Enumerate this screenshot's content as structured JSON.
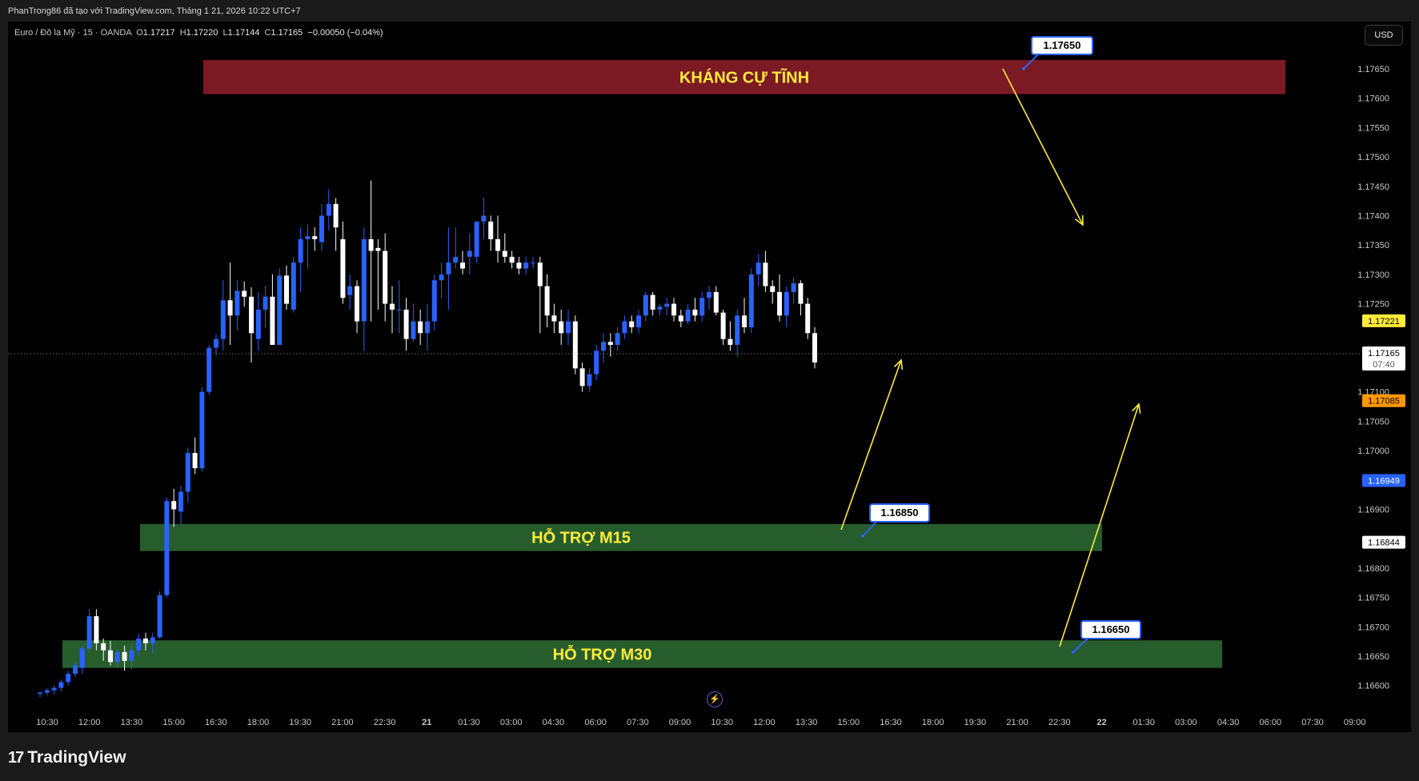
{
  "attribution": "PhanTrong86 đã tạo với TradingView.com, Tháng 1 21, 2026 10:22 UTC+7",
  "legend": {
    "symbol": "Euro / Đô la Mỹ · 15 · OANDA",
    "open_label": "O",
    "open": "1.17217",
    "high_label": "H",
    "high": "1.17220",
    "low_label": "L",
    "low": "1.17144",
    "close_label": "C",
    "close": "1.17165",
    "change": "−0.00050 (−0.04%)"
  },
  "currency_button": "USD",
  "branding": {
    "logo_mark": "17",
    "name": "TradingView"
  },
  "icons": {
    "logo": "tradingview-logo-icon",
    "lightning": "lightning-icon"
  },
  "colors": {
    "bullish": "#2962ff",
    "bearish": "#ffffff",
    "resistance_zone": "#7c1a23",
    "support_zone": "#275d2c",
    "zone_text": "#ffeb3b",
    "arrows": "#ffeb3b",
    "background": "#000000"
  },
  "chart_data": {
    "type": "candlestick",
    "symbol": "EURUSD",
    "timeframe": "15",
    "ylim": [
      1.1656,
      1.1774
    ],
    "x_tick_labels": [
      "10:30",
      "12:00",
      "13:30",
      "15:00",
      "16:30",
      "18:00",
      "19:30",
      "21:00",
      "22:30",
      "21",
      "01:30",
      "03:00",
      "04:30",
      "06:00",
      "07:30",
      "09:00",
      "10:30",
      "12:00",
      "13:30",
      "15:00",
      "16:30",
      "18:00",
      "19:30",
      "21:00",
      "22:30",
      "22",
      "01:30",
      "03:00",
      "04:30",
      "06:00",
      "07:30",
      "09:00"
    ],
    "y_tick_labels": [
      "1.17650",
      "1.17600",
      "1.17550",
      "1.17500",
      "1.17450",
      "1.17400",
      "1.17350",
      "1.17300",
      "1.17250",
      "1.17100",
      "1.17050",
      "1.17000",
      "1.16900",
      "1.16800",
      "1.16750",
      "1.16700",
      "1.16650",
      "1.16600"
    ],
    "price_labels": [
      {
        "value": "1.17221",
        "color": "#ffeb3b",
        "text_color": "#000000"
      },
      {
        "value": "1.17165",
        "color": "#26a69a",
        "text_color": "#ffffff"
      },
      {
        "value": "1.17165",
        "color": "#ffffff",
        "text_color": "#000000",
        "sub": "07:40"
      },
      {
        "value": "1.17085",
        "color": "#ff9800",
        "text_color": "#000000"
      },
      {
        "value": "1.16949",
        "color": "#2962ff",
        "text_color": "#ffffff"
      },
      {
        "value": "1.16844",
        "color": "#ffffff",
        "text_color": "#000000"
      }
    ],
    "current_price": 1.17165,
    "zones": [
      {
        "label": "KHÁNG CỰ TĨNH",
        "top": 1.17665,
        "bottom": 1.17607,
        "color": "#7c1a23",
        "start_index": 29,
        "end_time_index": 30
      },
      {
        "label": "HỖ TRỢ M15",
        "top": 1.16875,
        "bottom": 1.16829,
        "color": "#275d2c",
        "start_index": 23,
        "end_time_index": 25
      },
      {
        "label": "HỖ TRỢ M30",
        "top": 1.16677,
        "bottom": 1.1663,
        "color": "#275d2c",
        "start_index": 6,
        "end_time_index": 28
      }
    ],
    "price_callouts": [
      "1.17650",
      "1.16850",
      "1.16650"
    ],
    "candles": [
      [
        1.16586,
        1.1659,
        1.1658,
        1.16588
      ],
      [
        1.16588,
        1.16595,
        1.16583,
        1.16592
      ],
      [
        1.16592,
        1.166,
        1.16585,
        1.16596
      ],
      [
        1.16596,
        1.1661,
        1.1659,
        1.16606
      ],
      [
        1.16606,
        1.16625,
        1.166,
        1.1662
      ],
      [
        1.1662,
        1.1664,
        1.16615,
        1.16635
      ],
      [
        1.1663,
        1.16668,
        1.1662,
        1.16663
      ],
      [
        1.16663,
        1.1673,
        1.16655,
        1.16718
      ],
      [
        1.16718,
        1.1673,
        1.1666,
        1.16672
      ],
      [
        1.16672,
        1.1668,
        1.16642,
        1.1666
      ],
      [
        1.1666,
        1.16676,
        1.16634,
        1.1664
      ],
      [
        1.1664,
        1.16662,
        1.1663,
        1.16657
      ],
      [
        1.16657,
        1.16668,
        1.16625,
        1.16642
      ],
      [
        1.16642,
        1.1667,
        1.16628,
        1.1666
      ],
      [
        1.1666,
        1.16688,
        1.1665,
        1.1668
      ],
      [
        1.1668,
        1.1669,
        1.1666,
        1.16672
      ],
      [
        1.16672,
        1.1669,
        1.16655,
        1.16682
      ],
      [
        1.16682,
        1.1676,
        1.1668,
        1.16754
      ],
      [
        1.16754,
        1.1692,
        1.1675,
        1.16914
      ],
      [
        1.16914,
        1.16935,
        1.1687,
        1.169
      ],
      [
        1.16896,
        1.1694,
        1.16875,
        1.1693
      ],
      [
        1.1693,
        1.17005,
        1.16912,
        1.16996
      ],
      [
        1.16996,
        1.17022,
        1.1696,
        1.1697
      ],
      [
        1.1697,
        1.17108,
        1.16965,
        1.171
      ],
      [
        1.171,
        1.1718,
        1.17095,
        1.17175
      ],
      [
        1.17175,
        1.17198,
        1.17162,
        1.1719
      ],
      [
        1.1719,
        1.1729,
        1.1717,
        1.17256
      ],
      [
        1.17256,
        1.1732,
        1.1718,
        1.1723
      ],
      [
        1.1723,
        1.1729,
        1.17205,
        1.17272
      ],
      [
        1.17272,
        1.17288,
        1.17245,
        1.17262
      ],
      [
        1.17262,
        1.17278,
        1.1715,
        1.172
      ],
      [
        1.1719,
        1.1727,
        1.1717,
        1.1724
      ],
      [
        1.1724,
        1.1728,
        1.1721,
        1.17262
      ],
      [
        1.17262,
        1.173,
        1.1719,
        1.1718
      ],
      [
        1.1718,
        1.1731,
        1.1718,
        1.17298
      ],
      [
        1.17298,
        1.17315,
        1.1724,
        1.1725
      ],
      [
        1.1724,
        1.1733,
        1.17235,
        1.1732
      ],
      [
        1.1732,
        1.1738,
        1.1727,
        1.1736
      ],
      [
        1.1736,
        1.17385,
        1.1731,
        1.17365
      ],
      [
        1.17365,
        1.1738,
        1.1734,
        1.1736
      ],
      [
        1.17355,
        1.1742,
        1.1734,
        1.174
      ],
      [
        1.174,
        1.17445,
        1.17375,
        1.1742
      ],
      [
        1.1742,
        1.1743,
        1.1734,
        1.1738
      ],
      [
        1.1736,
        1.1739,
        1.1725,
        1.1726
      ],
      [
        1.17265,
        1.173,
        1.1724,
        1.1728
      ],
      [
        1.1728,
        1.1729,
        1.172,
        1.1722
      ],
      [
        1.1722,
        1.1738,
        1.1717,
        1.1736
      ],
      [
        1.1736,
        1.1746,
        1.1722,
        1.1734
      ],
      [
        1.17345,
        1.1736,
        1.1724,
        1.1734
      ],
      [
        1.1734,
        1.1737,
        1.1722,
        1.1725
      ],
      [
        1.1725,
        1.1728,
        1.172,
        1.1724
      ],
      [
        1.1724,
        1.1729,
        1.172,
        1.1724
      ],
      [
        1.1724,
        1.1726,
        1.1717,
        1.1719
      ],
      [
        1.1719,
        1.1725,
        1.17185,
        1.1722
      ],
      [
        1.1722,
        1.1724,
        1.1718,
        1.172
      ],
      [
        1.172,
        1.1725,
        1.1717,
        1.1722
      ],
      [
        1.1722,
        1.173,
        1.17205,
        1.1729
      ],
      [
        1.1729,
        1.1732,
        1.1726,
        1.173
      ],
      [
        1.173,
        1.1738,
        1.1724,
        1.1732
      ],
      [
        1.1732,
        1.1738,
        1.1731,
        1.1733
      ],
      [
        1.1732,
        1.1734,
        1.173,
        1.1731
      ],
      [
        1.1733,
        1.1737,
        1.173,
        1.1734
      ],
      [
        1.1733,
        1.1739,
        1.1732,
        1.1739
      ],
      [
        1.1739,
        1.1743,
        1.1736,
        1.174
      ],
      [
        1.1739,
        1.174,
        1.1734,
        1.1736
      ],
      [
        1.1736,
        1.174,
        1.1732,
        1.1734
      ],
      [
        1.1734,
        1.1737,
        1.1732,
        1.1733
      ],
      [
        1.1733,
        1.1734,
        1.1731,
        1.1732
      ],
      [
        1.1732,
        1.1733,
        1.173,
        1.1731
      ],
      [
        1.1731,
        1.1733,
        1.173,
        1.1732
      ],
      [
        1.1732,
        1.1733,
        1.1731,
        1.1732
      ],
      [
        1.1732,
        1.1733,
        1.172,
        1.1728
      ],
      [
        1.1728,
        1.173,
        1.1721,
        1.1723
      ],
      [
        1.1723,
        1.1725,
        1.172,
        1.1722
      ],
      [
        1.1722,
        1.1724,
        1.1718,
        1.172
      ],
      [
        1.172,
        1.1724,
        1.1718,
        1.1722
      ],
      [
        1.1722,
        1.1723,
        1.1713,
        1.1714
      ],
      [
        1.1714,
        1.1715,
        1.171,
        1.1711
      ],
      [
        1.1711,
        1.1714,
        1.171,
        1.1713
      ],
      [
        1.1713,
        1.1718,
        1.1712,
        1.1717
      ],
      [
        1.1717,
        1.172,
        1.1715,
        1.17185
      ],
      [
        1.17185,
        1.172,
        1.1716,
        1.1718
      ],
      [
        1.1718,
        1.1721,
        1.1717,
        1.172
      ],
      [
        1.172,
        1.1723,
        1.1719,
        1.1722
      ],
      [
        1.1722,
        1.1723,
        1.172,
        1.1721
      ],
      [
        1.1721,
        1.1724,
        1.172,
        1.1723
      ],
      [
        1.1723,
        1.1727,
        1.1722,
        1.17265
      ],
      [
        1.17265,
        1.1727,
        1.1723,
        1.1724
      ],
      [
        1.1724,
        1.1725,
        1.1723,
        1.17245
      ],
      [
        1.17245,
        1.1726,
        1.1723,
        1.1725
      ],
      [
        1.1725,
        1.1726,
        1.1722,
        1.1723
      ],
      [
        1.1723,
        1.1724,
        1.1721,
        1.1722
      ],
      [
        1.1722,
        1.1725,
        1.17215,
        1.1724
      ],
      [
        1.1724,
        1.1726,
        1.1722,
        1.1723
      ],
      [
        1.1723,
        1.1727,
        1.1722,
        1.1726
      ],
      [
        1.1726,
        1.1728,
        1.1724,
        1.1727
      ],
      [
        1.1727,
        1.1728,
        1.1723,
        1.17235
      ],
      [
        1.17235,
        1.1724,
        1.1718,
        1.1719
      ],
      [
        1.1719,
        1.1722,
        1.1717,
        1.1718
      ],
      [
        1.1718,
        1.1724,
        1.1716,
        1.1723
      ],
      [
        1.1723,
        1.1726,
        1.172,
        1.1721
      ],
      [
        1.1721,
        1.1731,
        1.172,
        1.173
      ],
      [
        1.173,
        1.17335,
        1.1728,
        1.1732
      ],
      [
        1.1732,
        1.1734,
        1.1727,
        1.1728
      ],
      [
        1.1728,
        1.1729,
        1.1725,
        1.1727
      ],
      [
        1.1727,
        1.173,
        1.1722,
        1.1723
      ],
      [
        1.1723,
        1.1728,
        1.1721,
        1.1727
      ],
      [
        1.1727,
        1.17295,
        1.1725,
        1.17285
      ],
      [
        1.17285,
        1.1729,
        1.1723,
        1.1725
      ],
      [
        1.1725,
        1.1726,
        1.1719,
        1.172
      ],
      [
        1.172,
        1.1721,
        1.1714,
        1.1715
      ]
    ]
  }
}
